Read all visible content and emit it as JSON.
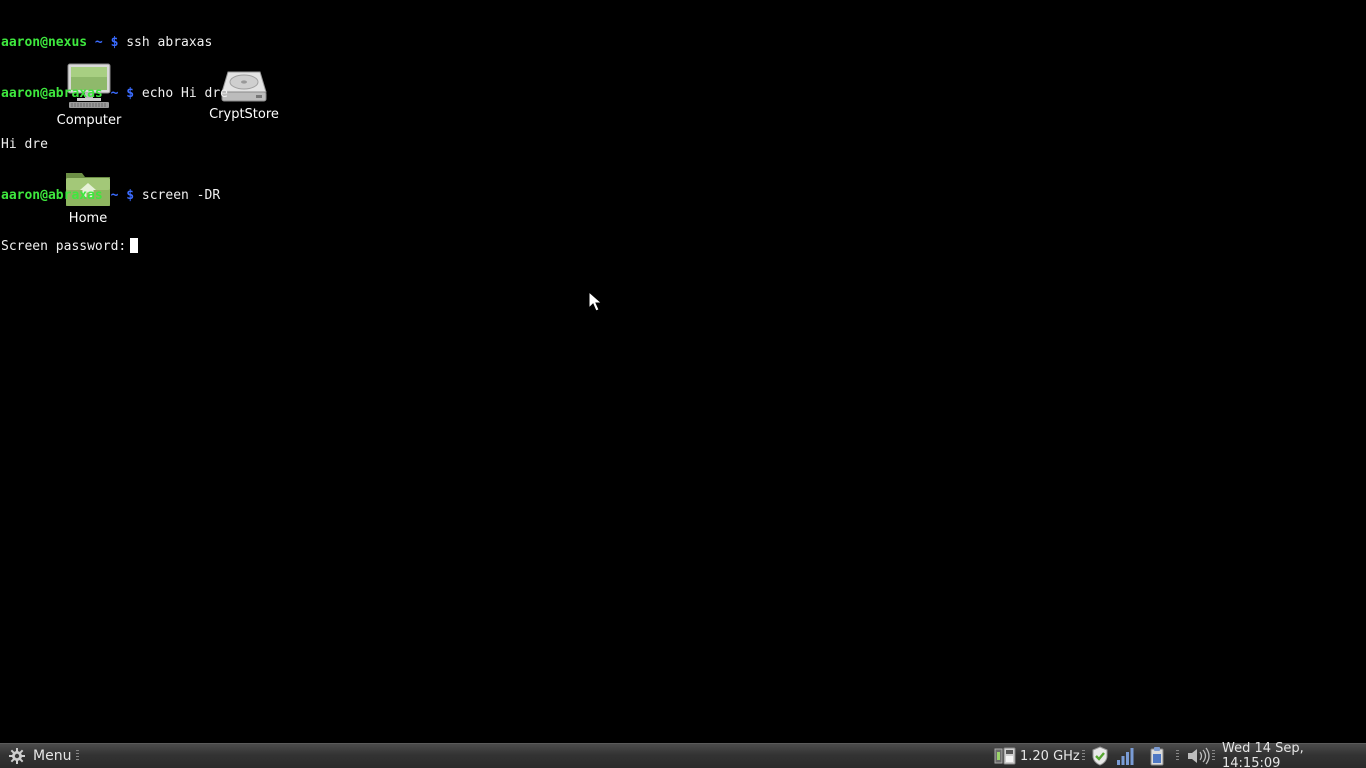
{
  "terminal": {
    "lines": [
      {
        "user_host": "aaron@nexus",
        "tilde": "~",
        "dollar": "$",
        "command": "ssh abraxas"
      },
      {
        "user_host": "aaron@abraxas",
        "tilde": "~",
        "dollar": "$",
        "command": "echo Hi dre"
      },
      {
        "output": "Hi dre"
      },
      {
        "user_host": "aaron@abraxas",
        "tilde": "~",
        "dollar": "$",
        "command": "screen -DR"
      }
    ],
    "password_prompt": "Screen password:"
  },
  "desktop": {
    "icons": [
      {
        "label": "Computer",
        "icon": "computer-icon"
      },
      {
        "label": "CryptStore",
        "icon": "drive-icon"
      },
      {
        "label": "Home",
        "icon": "home-folder-icon"
      }
    ]
  },
  "panel": {
    "menu_label": "Menu",
    "menu_icon": "gear-icon",
    "cpu_frequency": "1.20 GHz",
    "clock": "Wed 14 Sep, 14:15:09",
    "tray_icons": [
      "cpu-icon",
      "security-shield-icon",
      "network-signal-icon",
      "clipboard-icon",
      "volume-icon"
    ]
  },
  "colors": {
    "prompt_user_host": "#3ee83e",
    "prompt_symbols": "#3a6bff",
    "background": "#000000"
  }
}
